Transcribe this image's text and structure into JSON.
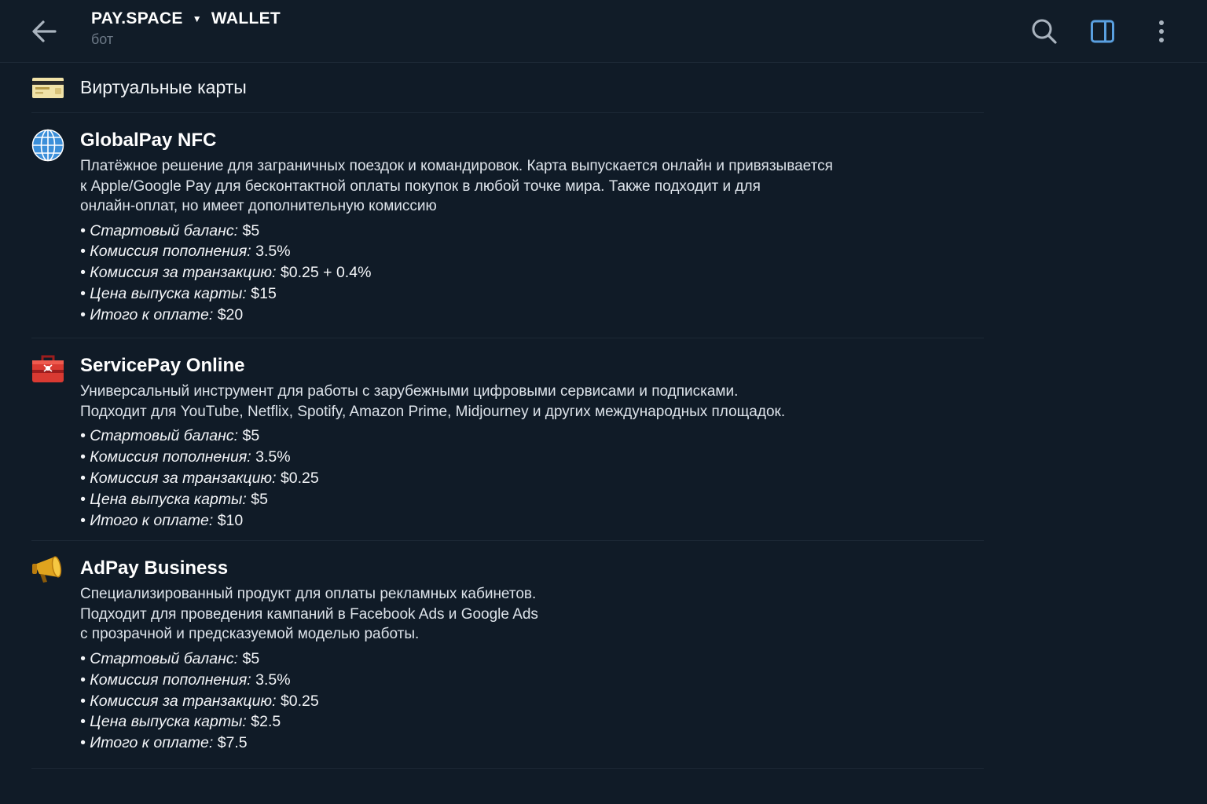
{
  "header": {
    "title_left": "PAY.SPACE",
    "title_separator": "▼",
    "title_right": "WALLET",
    "subtitle": "бот",
    "icons": [
      "arrow-left-icon",
      "search-icon",
      "sidebar-panel-icon",
      "more-vertical-icon"
    ]
  },
  "section": {
    "emoji": "credit-card-emoji",
    "title": "Виртуальные карты"
  },
  "cards": [
    {
      "emoji": "globe-emoji",
      "title": "GlobalPay NFC",
      "desc": [
        "Платёжное решение для заграничных поездок и командировок. Карта выпускается онлайн и привязывается",
        "к Apple/Google Pay для бесконтактной оплаты покупок в любой точке мира. Также подходит и для",
        "онлайн-оплат, но имеет дополнительную комиссию"
      ],
      "bullets": [
        {
          "label": "• Стартовый баланс:",
          "value": "$5"
        },
        {
          "label": "• Комиссия пополнения:",
          "value": "3.5%"
        },
        {
          "label": "• Комиссия за транзакцию:",
          "value": "$0.25 + 0.4%"
        },
        {
          "label": "• Цена выпуска карты:",
          "value": "$15"
        },
        {
          "label": "• Итого к оплате:",
          "value": "$20"
        }
      ]
    },
    {
      "emoji": "toolbox-emoji",
      "title": "ServicePay Online",
      "desc": [
        "Универсальный инструмент для работы с зарубежными цифровыми сервисами и подписками.",
        "Подходит для YouTube, Netflix, Spotify, Amazon Prime, Midjourney и других международных площадок."
      ],
      "bullets": [
        {
          "label": "• Стартовый баланс:",
          "value": "$5"
        },
        {
          "label": "• Комиссия пополнения:",
          "value": "3.5%"
        },
        {
          "label": "• Комиссия за транзакцию:",
          "value": "$0.25"
        },
        {
          "label": "• Цена выпуска карты:",
          "value": "$5"
        },
        {
          "label": "• Итого к оплате:",
          "value": "$10"
        }
      ]
    },
    {
      "emoji": "megaphone-emoji",
      "title": "AdPay Business",
      "desc": [
        "Специализированный продукт для оплаты рекламных кабинетов.",
        "Подходит для проведения кампаний в Facebook Ads и Google Ads",
        "с прозрачной и предсказуемой моделью работы."
      ],
      "bullets": [
        {
          "label": "• Стартовый баланс:",
          "value": "$5"
        },
        {
          "label": "• Комиссия пополнения:",
          "value": "3.5%"
        },
        {
          "label": "• Комиссия за транзакцию:",
          "value": "$0.25"
        },
        {
          "label": "• Цена выпуска карты:",
          "value": "$2.5"
        },
        {
          "label": "• Итого к оплате:",
          "value": "$7.5"
        }
      ]
    }
  ],
  "colors": {
    "background": "#101b27",
    "divider": "#1c2835",
    "accent": "#5aa0e0",
    "muted": "#6c7886"
  }
}
